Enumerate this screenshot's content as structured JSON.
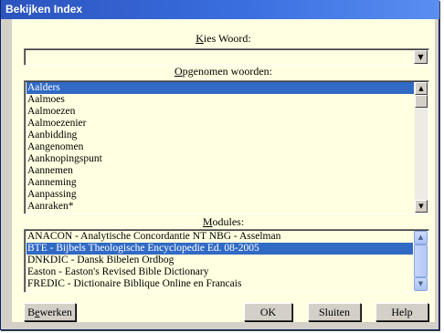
{
  "window": {
    "title": "Bekijken Index"
  },
  "kies_woord": {
    "label": "Kies Woord:",
    "value": "",
    "dropdown_icon": "triangle-down-icon"
  },
  "opgenomen": {
    "label": "Opgenomen woorden:",
    "items": [
      {
        "label": "Aalders",
        "selected": true
      },
      {
        "label": "Aalmoes",
        "selected": false
      },
      {
        "label": "Aalmoezen",
        "selected": false
      },
      {
        "label": "Aalmoezenier",
        "selected": false
      },
      {
        "label": "Aanbidding",
        "selected": false
      },
      {
        "label": "Aangenomen",
        "selected": false
      },
      {
        "label": "Aanknopingspunt",
        "selected": false
      },
      {
        "label": "Aannemen",
        "selected": false
      },
      {
        "label": "Aanneming",
        "selected": false
      },
      {
        "label": "Aanpassing",
        "selected": false
      },
      {
        "label": "Aanraken*",
        "selected": false
      }
    ]
  },
  "modules": {
    "label": "Modules:",
    "items": [
      {
        "label": "ANACON - Analytische Concordantie NT NBG - Asselman",
        "selected": false
      },
      {
        "label": "BTE - Bijbels Theologische Encyclopedie Ed. 08-2005",
        "selected": true
      },
      {
        "label": "DNKDIC - Dansk Bibelen Ordbog",
        "selected": false
      },
      {
        "label": "Easton - Easton's Revised Bible Dictionary",
        "selected": false
      },
      {
        "label": "FREDIC - Dictionaire Biblique Online en Francais",
        "selected": false
      }
    ]
  },
  "buttons": {
    "bewerken": "Bewerken",
    "ok": "OK",
    "sluiten": "Sluiten",
    "help": "Help"
  },
  "colors": {
    "selection": "#316ac5",
    "client_background": "#ffffe1",
    "titlebar": "#2b54bd"
  }
}
